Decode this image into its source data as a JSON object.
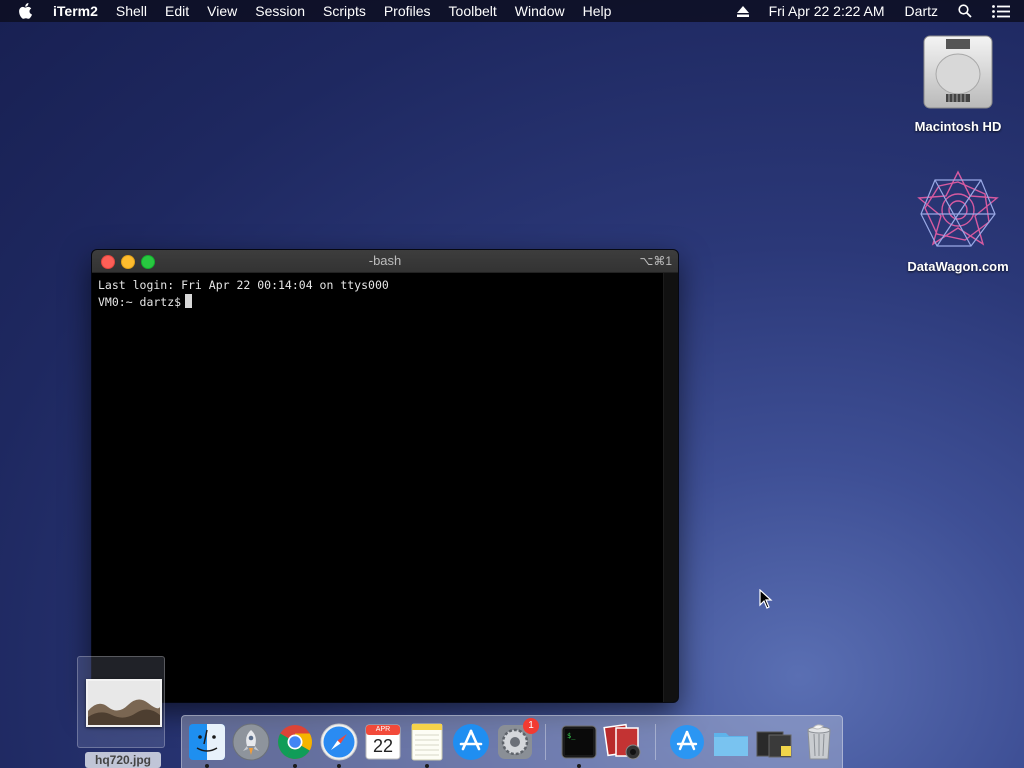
{
  "menubar": {
    "app_name": "iTerm2",
    "menus": [
      "Shell",
      "Edit",
      "View",
      "Session",
      "Scripts",
      "Profiles",
      "Toolbelt",
      "Window",
      "Help"
    ],
    "datetime": "Fri Apr 22  2:22 AM",
    "user": "Dartz",
    "icons": [
      "apple-icon",
      "eject-icon",
      "spotlight-search-icon",
      "notification-center-icon"
    ]
  },
  "desktop": {
    "icons": [
      {
        "label": "Macintosh HD",
        "icon": "hard-drive-icon"
      },
      {
        "label": "DataWagon.com",
        "icon": "datawagon-logo-icon"
      }
    ],
    "thumbnail_label": "hq720.jpg"
  },
  "terminal": {
    "title": "-bash",
    "shortcut": "⌥⌘1",
    "lines": [
      "Last login: Fri Apr 22 00:14:04 on ttys000",
      "VM0:~ dartz$"
    ]
  },
  "dock": {
    "items": [
      {
        "name": "finder",
        "running": true
      },
      {
        "name": "launchpad",
        "running": false
      },
      {
        "name": "chrome",
        "running": true
      },
      {
        "name": "safari",
        "running": true
      },
      {
        "name": "calendar",
        "running": false,
        "month": "APR",
        "day": "22"
      },
      {
        "name": "notes",
        "running": true
      },
      {
        "name": "app-store",
        "running": false
      },
      {
        "name": "system-preferences",
        "running": false,
        "badge": "1"
      },
      {
        "name": "iterm2",
        "running": true
      },
      {
        "name": "photo-booth",
        "running": false
      },
      {
        "name": "app-store-folder",
        "running": false
      },
      {
        "name": "folder",
        "running": false
      },
      {
        "name": "stack",
        "running": false
      },
      {
        "name": "trash",
        "running": false
      }
    ]
  }
}
